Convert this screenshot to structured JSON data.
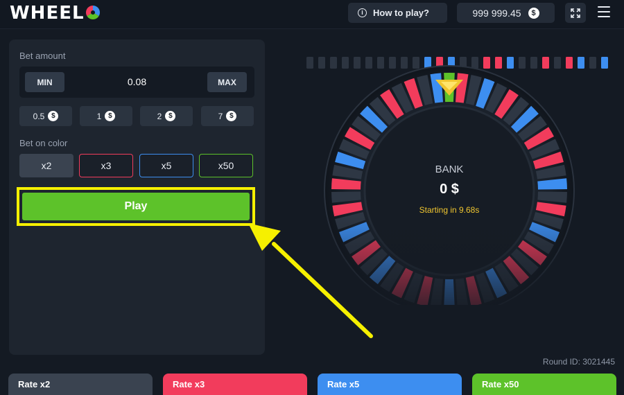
{
  "header": {
    "logo_text": "WHEEL",
    "howto_label": "How to play?",
    "balance": "999 999.45",
    "currency_symbol": "$"
  },
  "bet_panel": {
    "bet_amount_label": "Bet amount",
    "min_label": "MIN",
    "max_label": "MAX",
    "bet_value": "0.08",
    "quick_bets": [
      "0.5",
      "1",
      "2",
      "7"
    ],
    "bet_on_color_label": "Bet on color",
    "color_options": [
      "x2",
      "x3",
      "x5",
      "x50"
    ],
    "play_label": "Play"
  },
  "wheel": {
    "bank_label": "BANK",
    "bank_value": "0 $",
    "countdown": "Starting in 9.68s",
    "round_id": "Round ID: 3021445"
  },
  "rates": [
    {
      "label": "Rate x2",
      "color": "#3a4350"
    },
    {
      "label": "Rate x3",
      "color": "#f23c5c"
    },
    {
      "label": "Rate x5",
      "color": "#3d8ef0"
    },
    {
      "label": "Rate x50",
      "color": "#5dc22a"
    }
  ],
  "colors": {
    "gray": "#2e3744",
    "red": "#f23c5c",
    "blue": "#3d8ef0",
    "green": "#5dc22a",
    "highlight": "#f6f000",
    "pointer": "#f0c630"
  },
  "history_strip": [
    "gray",
    "gray",
    "gray",
    "gray",
    "gray",
    "gray",
    "gray",
    "gray",
    "gray",
    "gray",
    "blue",
    "red",
    "blue",
    "gray",
    "gray",
    "red",
    "red",
    "blue",
    "gray",
    "gray",
    "red",
    "gray",
    "red",
    "blue",
    "gray",
    "blue",
    "gray"
  ]
}
